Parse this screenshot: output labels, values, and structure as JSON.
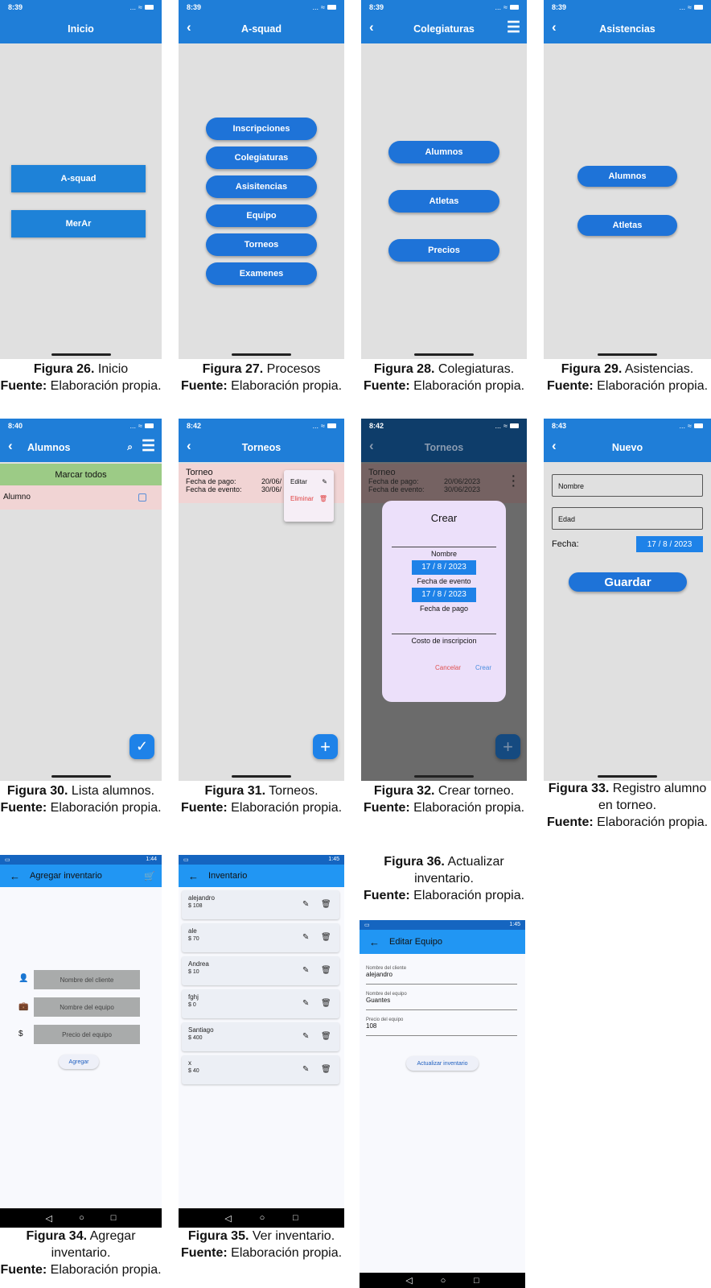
{
  "status": {
    "t839": "8:39",
    "t840": "8:40",
    "t842": "8:42",
    "t843": "8:43",
    "t144": "1:44",
    "t145": "1:45",
    "signal": "...",
    "wifi": "≈"
  },
  "inicio": {
    "title": "Inicio",
    "buttons": [
      "A-squad",
      "MerAr"
    ]
  },
  "asquad": {
    "title": "A-squad",
    "buttons": [
      "Inscripciones",
      "Colegiaturas",
      "Asisitencias",
      "Equipo",
      "Torneos",
      "Examenes"
    ]
  },
  "colegiaturas": {
    "title": "Colegiaturas",
    "buttons": [
      "Alumnos",
      "Atletas",
      "Precios"
    ]
  },
  "asistencias": {
    "title": "Asistencias",
    "buttons": [
      "Alumnos",
      "Atletas"
    ]
  },
  "alumnos": {
    "title": "Alumnos",
    "mark_all": "Marcar todos",
    "row": "Alumno"
  },
  "torneos": {
    "title": "Torneos",
    "card_title": "Torneo",
    "pay_label": "Fecha de pago:",
    "pay_value": "20/06/",
    "event_label": "Fecha de evento:",
    "event_value": "30/06/",
    "menu_edit": "Editar",
    "menu_delete": "Eliminar"
  },
  "crear": {
    "title": "Torneos",
    "card_title": "Torneo",
    "pay_label": "Fecha de pago:",
    "pay_value": "20/06/2023",
    "event_label": "Fecha de evento:",
    "event_value": "30/06/2023",
    "dialog_title": "Crear",
    "name_label": "Nombre",
    "date1": "17 / 8 / 2023",
    "event_label2": "Fecha de evento",
    "date2": "17 / 8 / 2023",
    "pay_label2": "Fecha de pago",
    "cost_label": "Costo de inscripcion",
    "cancel": "Cancelar",
    "create": "Crear"
  },
  "nuevo": {
    "title": "Nuevo",
    "name_ph": "Nombre",
    "age_ph": "Edad",
    "date_label": "Fecha:",
    "date_value": "17 / 8 / 2023",
    "save": "Guardar"
  },
  "agregar": {
    "title": "Agregar inventario",
    "client_ph": "Nombre del cliente",
    "equip_ph": "Nombre del equipo",
    "price_ph": "Precio del equipo",
    "add": "Agregar"
  },
  "inventario": {
    "title": "Inventario",
    "items": [
      {
        "name": "alejandro",
        "price": "$ 108"
      },
      {
        "name": "ale",
        "price": "$ 70"
      },
      {
        "name": "Andrea",
        "price": "$ 10"
      },
      {
        "name": "fghj",
        "price": "$ 0"
      },
      {
        "name": "Santiago",
        "price": "$ 400"
      },
      {
        "name": "x",
        "price": "$ 40"
      }
    ]
  },
  "editar": {
    "title": "Editar Equipo",
    "client_label": "Nombre del cliente",
    "client_value": "alejandro",
    "equip_label": "Nombre del equipo",
    "equip_value": "Guantes",
    "price_label": "Precio del equipo",
    "price_value": "108",
    "update": "Actualizar inventario"
  },
  "captions": {
    "c26": {
      "fig": "Figura 26.",
      "name": " Inicio",
      "src": "Fuente:",
      "src_text": " Elaboración propia."
    },
    "c27": {
      "fig": "Figura 27.",
      "name": " Procesos",
      "src": "Fuente:",
      "src_text": " Elaboración propia."
    },
    "c28": {
      "fig": "Figura 28.",
      "name": " Colegiaturas.",
      "src": "Fuente:",
      "src_text": " Elaboración propia."
    },
    "c29": {
      "fig": "Figura 29.",
      "name": " Asistencias.",
      "src": "Fuente:",
      "src_text": " Elaboración propia."
    },
    "c30": {
      "fig": "Figura 30.",
      "name": " Lista alumnos.",
      "src": "Fuente:",
      "src_text": " Elaboración propia."
    },
    "c31": {
      "fig": "Figura 31.",
      "name": " Torneos.",
      "src": "Fuente:",
      "src_text": " Elaboración propia."
    },
    "c32": {
      "fig": "Figura 32.",
      "name": " Crear torneo.",
      "src": "Fuente:",
      "src_text": " Elaboración propia."
    },
    "c33": {
      "fig": "Figura 33.",
      "name": " Registro alumno en torneo.",
      "src": "Fuente:",
      "src_text": " Elaboración propia."
    },
    "c34": {
      "fig": "Figura 34.",
      "name": " Agregar inventario.",
      "src": "Fuente:",
      "src_text": " Elaboración propia."
    },
    "c35": {
      "fig": "Figura 35.",
      "name": " Ver inventario.",
      "src": "Fuente:",
      "src_text": " Elaboración propia."
    },
    "c36": {
      "fig": "Figura 36.",
      "name": " Actualizar inventario.",
      "src": "Fuente:",
      "src_text": " Elaboración propia."
    }
  }
}
